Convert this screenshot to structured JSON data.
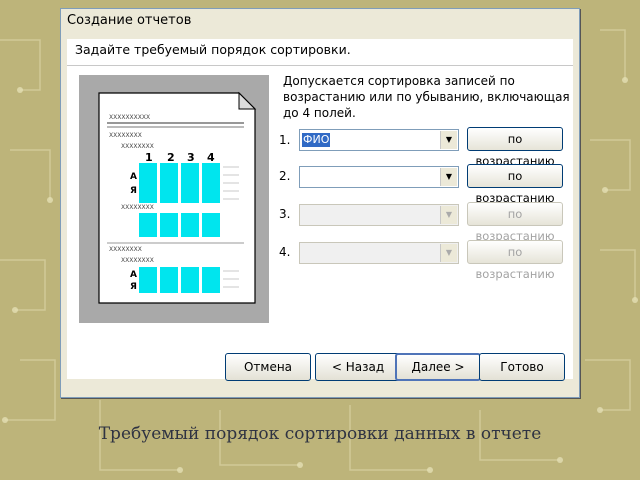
{
  "window": {
    "title": "Создание отчетов",
    "header": "Задайте требуемый порядок сортировки.",
    "description": "Допускается сортировка записей по возрастанию или по убыванию, включающая до 4 полей."
  },
  "preview": {
    "title_placeholder": "XXXXXXXXXX",
    "group_placeholder": "XXXXXXXX",
    "column_numbers": [
      "1",
      "2",
      "3",
      "4"
    ],
    "sort_glyph_top": "А",
    "sort_glyph_bottom": "Я",
    "colors": {
      "highlight": "#00e5ee",
      "paper": "#ffffff",
      "frame": "#a9a9a9"
    }
  },
  "sort_rows": [
    {
      "number": "1.",
      "field": "ФИО",
      "order": "по возрастанию",
      "enabled": true
    },
    {
      "number": "2.",
      "field": "",
      "order": "по возрастанию",
      "enabled": true
    },
    {
      "number": "3.",
      "field": "",
      "order": "по возрастанию",
      "enabled": false
    },
    {
      "number": "4.",
      "field": "",
      "order": "по возрастанию",
      "enabled": false
    }
  ],
  "buttons": {
    "cancel": "Отмена",
    "back": "< Назад",
    "next": "Далее >",
    "finish": "Готово"
  },
  "icons": {
    "dropdown": "chevron-down-icon"
  },
  "caption": "Требуемый порядок сортировки данных в отчете"
}
